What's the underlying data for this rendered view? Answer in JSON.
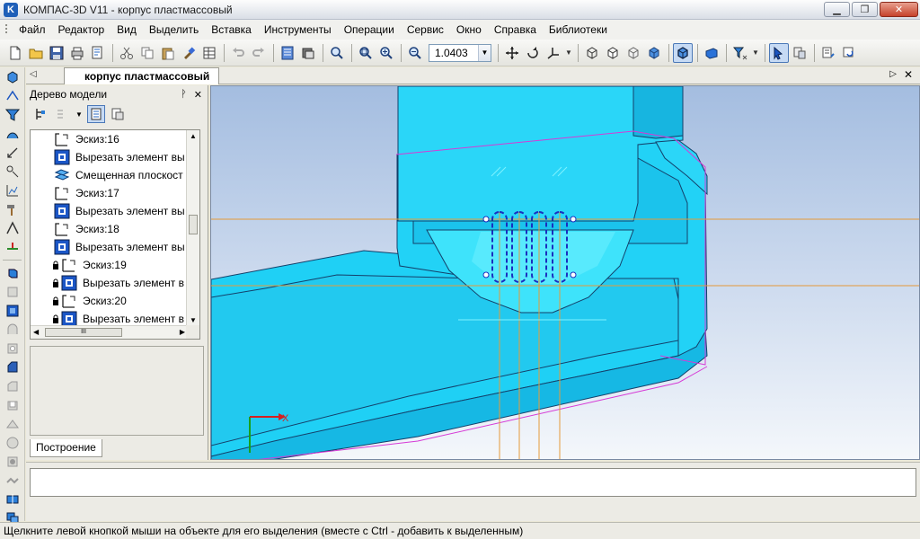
{
  "window": {
    "title": "КОМПАС-3D V11 - корпус пластмассовый",
    "app_icon_letter": "K",
    "minimize_glyph": "▁",
    "restore_glyph": "❐",
    "close_glyph": "✕"
  },
  "menu": {
    "items": [
      "Файл",
      "Редактор",
      "Вид",
      "Выделить",
      "Вставка",
      "Инструменты",
      "Операции",
      "Сервис",
      "Окно",
      "Справка",
      "Библиотеки"
    ]
  },
  "toolbar": {
    "zoom_value": "1.0403",
    "zoom_dropdown_glyph": "▼"
  },
  "document_tab": {
    "label": "корпус пластмассовый",
    "scroll_left_glyph": "◁",
    "scroll_right_glyph": "▷",
    "close_glyph": "✕"
  },
  "model_tree": {
    "title": "Дерево модели",
    "pin_glyph": "ᚹ",
    "close_glyph": "✕",
    "hscroll_grip": "III",
    "items": [
      {
        "label": "Эскиз:16",
        "icon": "sketch-icon",
        "locked": false
      },
      {
        "label": "Вырезать элемент вы",
        "icon": "extrude-cut-icon",
        "locked": false
      },
      {
        "label": "Смещенная плоскост",
        "icon": "offset-plane-icon",
        "locked": false
      },
      {
        "label": "Эскиз:17",
        "icon": "sketch-icon",
        "locked": false
      },
      {
        "label": "Вырезать элемент вы",
        "icon": "extrude-cut-icon",
        "locked": false
      },
      {
        "label": "Эскиз:18",
        "icon": "sketch-icon",
        "locked": false
      },
      {
        "label": "Вырезать элемент вы",
        "icon": "extrude-cut-icon",
        "locked": false
      },
      {
        "label": "Эскиз:19",
        "icon": "sketch-icon",
        "locked": true
      },
      {
        "label": "Вырезать элемент в",
        "icon": "extrude-cut-icon",
        "locked": true
      },
      {
        "label": "Эскиз:20",
        "icon": "sketch-icon",
        "locked": true
      },
      {
        "label": "Вырезать элемент в",
        "icon": "extrude-cut-icon",
        "locked": true
      }
    ],
    "bottom_tab": "Построение"
  },
  "viewport": {
    "axis_label_x": "X",
    "colors": {
      "part_fill": "#1fd0f5",
      "part_edge": "#14406a",
      "sketch": "#1a2fbf",
      "guide_line": "#e59a3a",
      "plane_outline": "#d63ad6",
      "axis_x": "#d52020",
      "axis_y": "#1aa01a"
    }
  },
  "statusbar": {
    "text": "Щелкните левой кнопкой мыши на объекте для его выделения (вместе с Ctrl - добавить к выделенным)"
  }
}
